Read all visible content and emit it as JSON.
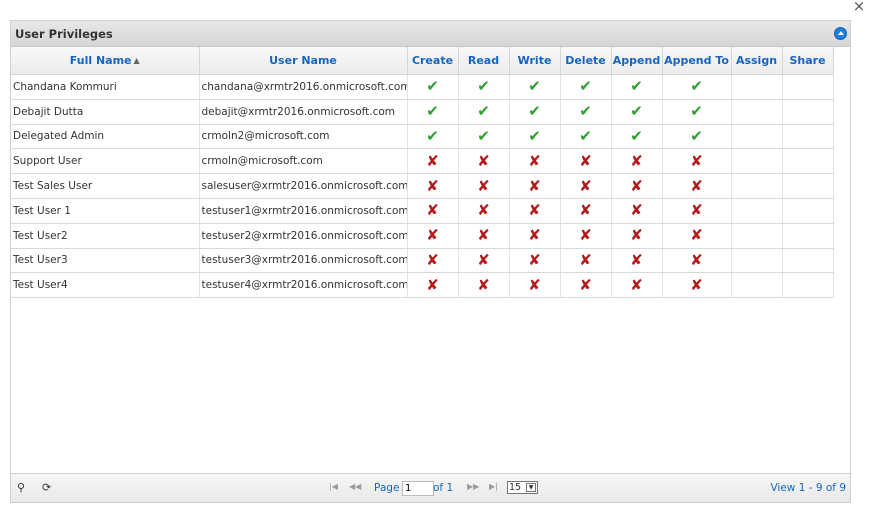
{
  "window": {
    "close_glyph": "×"
  },
  "panel": {
    "title": "User Privileges"
  },
  "columns": [
    "Full Name",
    "User Name",
    "Create",
    "Read",
    "Write",
    "Delete",
    "Append",
    "Append To",
    "Assign",
    "Share"
  ],
  "sort": {
    "column": "Full Name",
    "icon": "sort-icon"
  },
  "rows": [
    {
      "full_name": "Chandana Kommuri",
      "user_name": "chandana@xrmtr2016.onmicrosoft.com",
      "privileges": [
        "ok",
        "ok",
        "ok",
        "ok",
        "ok",
        "ok",
        "",
        ""
      ]
    },
    {
      "full_name": "Debajit Dutta",
      "user_name": "debajit@xrmtr2016.onmicrosoft.com",
      "privileges": [
        "ok",
        "ok",
        "ok",
        "ok",
        "ok",
        "ok",
        "",
        ""
      ]
    },
    {
      "full_name": "Delegated Admin",
      "user_name": "crmoln2@microsoft.com",
      "privileges": [
        "ok",
        "ok",
        "ok",
        "ok",
        "ok",
        "ok",
        "",
        ""
      ]
    },
    {
      "full_name": "Support User",
      "user_name": "crmoln@microsoft.com",
      "privileges": [
        "no",
        "no",
        "no",
        "no",
        "no",
        "no",
        "",
        ""
      ]
    },
    {
      "full_name": "Test Sales User",
      "user_name": "salesuser@xrmtr2016.onmicrosoft.com",
      "privileges": [
        "no",
        "no",
        "no",
        "no",
        "no",
        "no",
        "",
        ""
      ]
    },
    {
      "full_name": "Test User 1",
      "user_name": "testuser1@xrmtr2016.onmicrosoft.com",
      "privileges": [
        "no",
        "no",
        "no",
        "no",
        "no",
        "no",
        "",
        ""
      ]
    },
    {
      "full_name": "Test User2",
      "user_name": "testuser2@xrmtr2016.onmicrosoft.com",
      "privileges": [
        "no",
        "no",
        "no",
        "no",
        "no",
        "no",
        "",
        ""
      ]
    },
    {
      "full_name": "Test User3",
      "user_name": "testuser3@xrmtr2016.onmicrosoft.com",
      "privileges": [
        "no",
        "no",
        "no",
        "no",
        "no",
        "no",
        "",
        ""
      ]
    },
    {
      "full_name": "Test User4",
      "user_name": "testuser4@xrmtr2016.onmicrosoft.com",
      "privileges": [
        "no",
        "no",
        "no",
        "no",
        "no",
        "no",
        "",
        ""
      ]
    }
  ],
  "pager": {
    "page_label": "Page",
    "page_value": "1",
    "of_label": "of 1",
    "rows_per_page": "15",
    "view_count": "View 1 - 9 of 9"
  },
  "colors": {
    "accent": "#1565c0",
    "check": "#2e9e2e",
    "cross": "#b51a1a"
  }
}
